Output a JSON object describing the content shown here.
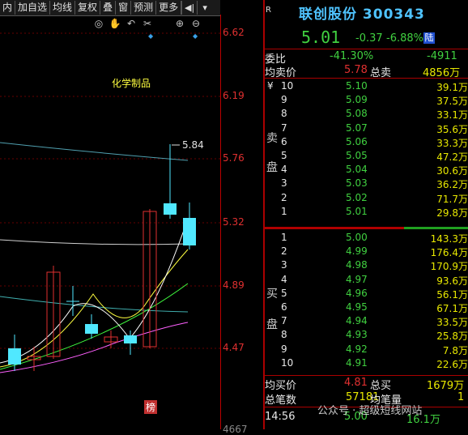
{
  "toolbar": {
    "buttons": [
      "内",
      "加自选",
      "均线",
      "复权",
      "叠",
      "窗",
      "预测",
      "更多"
    ],
    "icons": [
      "back-arrow-icon",
      "dropdown-arrow-icon"
    ]
  },
  "chart_tools": [
    "eye-icon",
    "hand-icon",
    "undo-icon",
    "scissors-icon",
    "zoom-in-icon",
    "zoom-out-icon"
  ],
  "chart": {
    "sector_label": "化学制品",
    "price_ticks": [
      "6.62",
      "6.19",
      "5.76",
      "5.32",
      "4.89",
      "4.47"
    ],
    "bottom_tick": "4667",
    "high_marker": "5.84",
    "bottom_tag": "榜",
    "colors": {
      "up": "#e03030",
      "down": "#50e8ff",
      "ma5": "#ffffff",
      "ma10": "#ffff40",
      "ma20": "#40ff40",
      "ma60": "#ff60ff"
    }
  },
  "stock": {
    "badge": "R",
    "name_code": "联创股份 300343",
    "price": "5.01",
    "change": "-0.37",
    "change_pct": "-6.88%",
    "board_tag": "陆"
  },
  "summary": {
    "webi_label": "委比",
    "webi_value": "-41.30%",
    "webi_diff": "-4911",
    "avg_sell_label": "均卖价",
    "avg_sell_value": "5.78",
    "total_sell_label": "总卖",
    "total_sell_value": "4856万"
  },
  "sell_side_label": [
    "卖",
    "盘"
  ],
  "sells": [
    {
      "level": "10",
      "price": "5.10",
      "vol": "39.1万",
      "prefix": "¥"
    },
    {
      "level": "9",
      "price": "5.09",
      "vol": "37.5万"
    },
    {
      "level": "8",
      "price": "5.08",
      "vol": "33.1万"
    },
    {
      "level": "7",
      "price": "5.07",
      "vol": "35.6万"
    },
    {
      "level": "6",
      "price": "5.06",
      "vol": "33.3万"
    },
    {
      "level": "5",
      "price": "5.05",
      "vol": "47.2万"
    },
    {
      "level": "4",
      "price": "5.04",
      "vol": "30.6万"
    },
    {
      "level": "3",
      "price": "5.03",
      "vol": "36.2万"
    },
    {
      "level": "2",
      "price": "5.02",
      "vol": "71.7万"
    },
    {
      "level": "1",
      "price": "5.01",
      "vol": "29.8万"
    }
  ],
  "buy_side_label": [
    "买",
    "盘"
  ],
  "buys": [
    {
      "level": "1",
      "price": "5.00",
      "vol": "143.3万"
    },
    {
      "level": "2",
      "price": "4.99",
      "vol": "176.4万"
    },
    {
      "level": "3",
      "price": "4.98",
      "vol": "170.9万"
    },
    {
      "level": "4",
      "price": "4.97",
      "vol": "93.6万"
    },
    {
      "level": "5",
      "price": "4.96",
      "vol": "56.1万"
    },
    {
      "level": "6",
      "price": "4.95",
      "vol": "67.1万"
    },
    {
      "level": "7",
      "price": "4.94",
      "vol": "33.5万"
    },
    {
      "level": "8",
      "price": "4.93",
      "vol": "25.8万"
    },
    {
      "level": "9",
      "price": "4.92",
      "vol": "7.8万"
    },
    {
      "level": "10",
      "price": "4.91",
      "vol": "22.6万"
    }
  ],
  "bottom": {
    "avg_buy_label": "均买价",
    "avg_buy_value": "4.81",
    "total_buy_label": "总买",
    "total_buy_value": "1679万",
    "total_trades_label": "总笔数",
    "total_trades_value": "57181",
    "avg_vol_label": "均笔量",
    "avg_vol_value": "1",
    "last_time": "14:56",
    "last_price": "5.00",
    "last_vol": "16.1万"
  },
  "watermark": "公众号 · 超级短线网站"
}
